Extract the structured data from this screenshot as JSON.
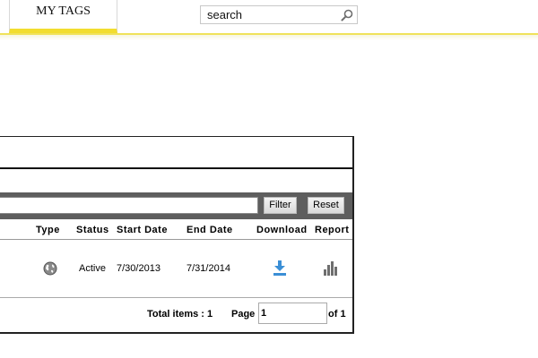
{
  "nav": {
    "tab_label": "MY TAGS",
    "search": {
      "value": "search",
      "placeholder": "search"
    }
  },
  "filter": {
    "input_value": "",
    "filter_label": "Filter",
    "reset_label": "Reset"
  },
  "table": {
    "columns": [
      "Type",
      "Status",
      "Start Date",
      "End Date",
      "Download",
      "Report"
    ],
    "rows": [
      {
        "type_icon": "globe-icon",
        "status": "Active",
        "start_date": "7/30/2013",
        "end_date": "7/31/2014",
        "download_icon": "download-icon",
        "report_icon": "bar-chart-icon"
      }
    ]
  },
  "pager": {
    "total_label": "Total items : 1",
    "page_label": "Page",
    "page_value": "1",
    "of_label": "of 1"
  },
  "colors": {
    "accent_yellow": "#f2dd2f",
    "filter_bar": "#5e5e5e",
    "download_blue": "#3b8fd6",
    "icon_gray": "#6e6e6e"
  }
}
